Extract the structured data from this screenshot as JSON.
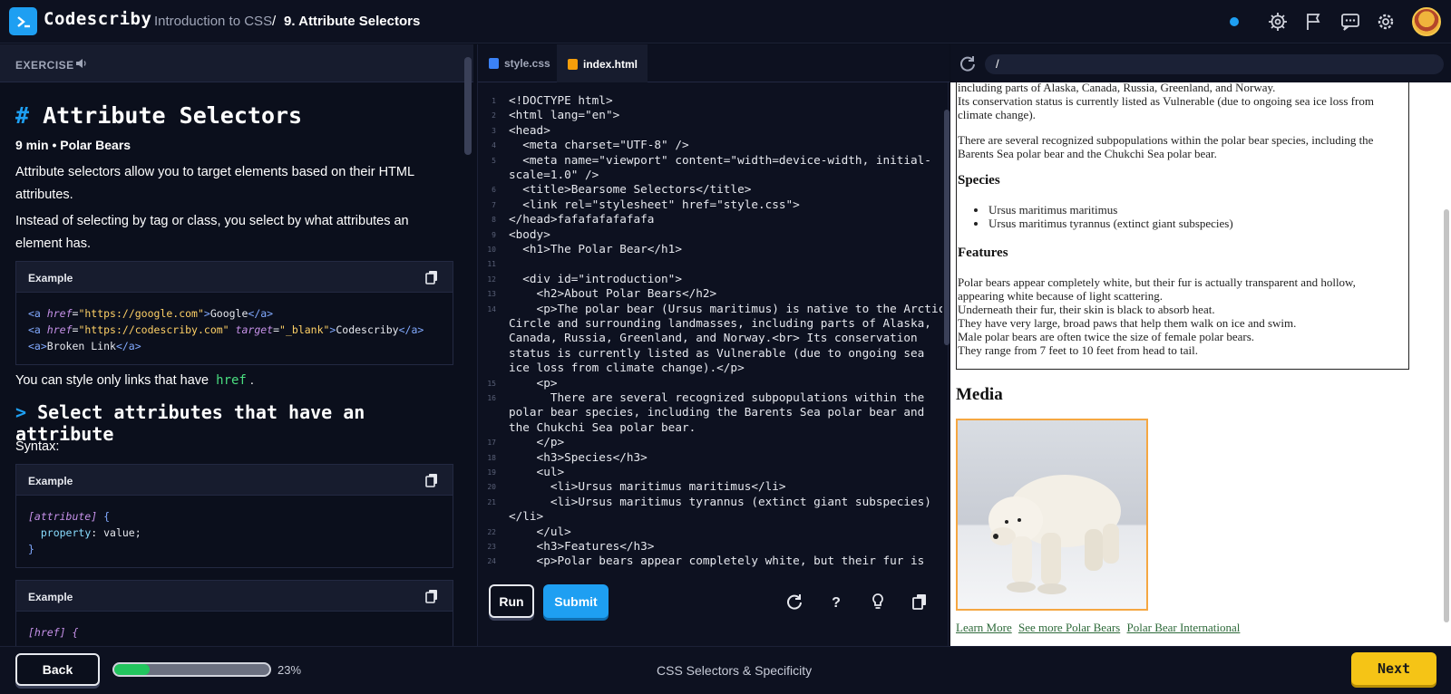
{
  "header": {
    "brand": "Codescriby",
    "course": "Introduction to CSS",
    "separator": "/",
    "lesson": "9. Attribute Selectors"
  },
  "exercise": {
    "label": "EXERCISE",
    "title_hash": "#",
    "title": "Attribute Selectors",
    "meta": "9 min • Polar Bears",
    "para1": "Attribute selectors allow you to target elements based on their HTML attributes.",
    "para2": "Instead of selecting by tag or class, you select by what attributes an element has.",
    "example_label": "Example",
    "example1_lines": [
      "<a href=\"https://google.com\">Google</a>",
      "<a href=\"https://codescriby.com\" target=\"_blank\">Codescriby</a>",
      "<a>Broken Link</a>"
    ],
    "style_note_prefix": "You can style only links that have",
    "style_note_code": "href",
    "style_note_suffix": ".",
    "section_title": "Select attributes that have an attribute",
    "syntax_label": "Syntax:",
    "example2_lines": [
      "[attribute] {",
      "  property: value;",
      "}"
    ],
    "example3_partial": "[href] {"
  },
  "editor": {
    "tabs": [
      {
        "label": "style.css",
        "active": false
      },
      {
        "label": "index.html",
        "active": true
      }
    ],
    "code_lines": [
      {
        "n": "1",
        "text": "<!DOCTYPE html>"
      },
      {
        "n": "2",
        "text": "<html lang=\"en\">"
      },
      {
        "n": "3",
        "text": "<head>"
      },
      {
        "n": "4",
        "text": "  <meta charset=\"UTF-8\" />"
      },
      {
        "n": "5",
        "text": "  <meta name=\"viewport\" content=\"width=device-width, initial-"
      },
      {
        "n": "",
        "text": "scale=1.0\" />"
      },
      {
        "n": "6",
        "text": "  <title>Bearsome Selectors</title>"
      },
      {
        "n": "7",
        "text": "  <link rel=\"stylesheet\" href=\"style.css\">"
      },
      {
        "n": "8",
        "text": "</head>fafafafafafafa"
      },
      {
        "n": "9",
        "text": "<body>"
      },
      {
        "n": "10",
        "text": "  <h1>The Polar Bear</h1>"
      },
      {
        "n": "11",
        "text": ""
      },
      {
        "n": "12",
        "text": "  <div id=\"introduction\">"
      },
      {
        "n": "13",
        "text": "    <h2>About Polar Bears</h2>"
      },
      {
        "n": "14",
        "text": "    <p>The polar bear (Ursus maritimus) is native to the Arctic"
      },
      {
        "n": "",
        "text": "Circle and surrounding landmasses, including parts of Alaska,"
      },
      {
        "n": "",
        "text": "Canada, Russia, Greenland, and Norway.<br> Its conservation"
      },
      {
        "n": "",
        "text": "status is currently listed as Vulnerable (due to ongoing sea"
      },
      {
        "n": "",
        "text": "ice loss from climate change).</p>"
      },
      {
        "n": "15",
        "text": "    <p>"
      },
      {
        "n": "16",
        "text": "      There are several recognized subpopulations within the"
      },
      {
        "n": "",
        "text": "polar bear species, including the Barents Sea polar bear and"
      },
      {
        "n": "",
        "text": "the Chukchi Sea polar bear."
      },
      {
        "n": "17",
        "text": "    </p>"
      },
      {
        "n": "18",
        "text": "    <h3>Species</h3>"
      },
      {
        "n": "19",
        "text": "    <ul>"
      },
      {
        "n": "20",
        "text": "      <li>Ursus maritimus maritimus</li>"
      },
      {
        "n": "21",
        "text": "      <li>Ursus maritimus tyrannus (extinct giant subspecies)"
      },
      {
        "n": "",
        "text": "</li>"
      },
      {
        "n": "22",
        "text": "    </ul>"
      },
      {
        "n": "23",
        "text": "    <h3>Features</h3>"
      },
      {
        "n": "24",
        "text": "    <p>Polar bears appear completely white, but their fur is"
      }
    ],
    "run_label": "Run",
    "submit_label": "Submit"
  },
  "preview": {
    "url": "/",
    "intro_lines": [
      "including parts of Alaska, Canada, Russia, Greenland, and Norway.",
      "Its conservation status is currently listed as Vulnerable (due to ongoing sea ice loss from",
      "climate change)."
    ],
    "subpop_lines": [
      "There are several recognized subpopulations within the polar bear species, including the",
      "Barents Sea polar bear and the Chukchi Sea polar bear."
    ],
    "species_heading": "Species",
    "species_items": [
      "Ursus maritimus maritimus",
      "Ursus maritimus tyrannus (extinct giant subspecies)"
    ],
    "features_heading": "Features",
    "features_lines": [
      "Polar bears appear completely white, but their fur is actually transparent and hollow,",
      "appearing white because of light scattering.",
      "Underneath their fur, their skin is black to absorb heat.",
      "They have very large, broad paws that help them walk on ice and swim.",
      "Male polar bears are often twice the size of female polar bears.",
      "They range from 7 feet to 10 feet from head to tail."
    ],
    "media_heading": "Media",
    "links": [
      "Learn More",
      "See more Polar Bears",
      "Polar Bear International"
    ]
  },
  "footer": {
    "back_label": "Back",
    "progress_percent": 23,
    "progress_label": "23%",
    "course_name": "CSS Selectors & Specificity",
    "next_label": "Next"
  },
  "colors": {
    "accent": "#1e9ff2",
    "progress": "#22c55e",
    "next_button": "#f5c416",
    "background": "#0b0f1c"
  }
}
